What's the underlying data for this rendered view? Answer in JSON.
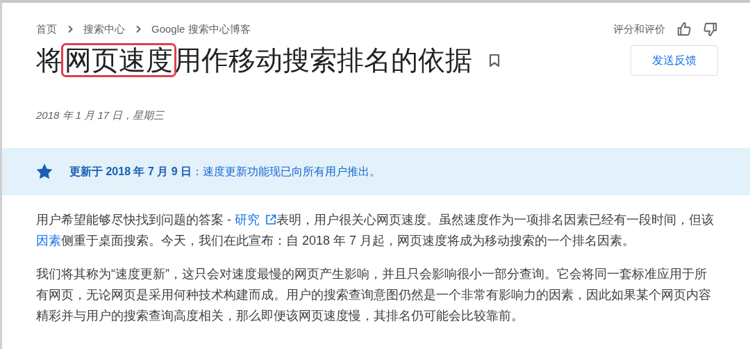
{
  "breadcrumbs": [
    "首页",
    "搜索中心",
    "Google 搜索中心博客"
  ],
  "rating": {
    "label": "评分和评价"
  },
  "title": [
    {
      "text": "将",
      "kind": "plain"
    },
    {
      "text": "网页速度",
      "kind": "highlight"
    },
    {
      "text": "用作移动搜索排名的依据",
      "kind": "plain"
    }
  ],
  "feedback_button": "发送反馈",
  "date": "2018 年 1 月 17 日，星期三",
  "notice": {
    "lead": "更新于 2018 年 7 月 9 日",
    "text": "：速度更新功能现已向所有用户推出。"
  },
  "paragraphs": [
    [
      {
        "text": "用户希望能够尽快找到问题的答案 - ",
        "kind": "text"
      },
      {
        "text": "研究",
        "kind": "external_link"
      },
      {
        "text": "表明，用户很关心网页速度。虽然速度作为一项排名因素已经有一段时间，但该",
        "kind": "text"
      },
      {
        "text": "因素",
        "kind": "link"
      },
      {
        "text": "侧重于桌面搜索。今天，我们在此宣布：自 2018 年 7 月起，网页速度将成为移动搜索的一个排名因素。",
        "kind": "text"
      }
    ],
    [
      {
        "text": "我们将其称为“速度更新”，这只会对速度最慢的网页产生影响，并且只会影响很小一部分查询。它会将同一套标准应用于所有网页，无论网页是采用何种技术构建而成。用户的搜索查询意图仍然是一个非常有影响力的因素，因此如果某个网页内容精彩并与用户的搜索查询高度相关，那么即便该网页速度慢，其排名仍可能会比较靠前。",
        "kind": "text"
      }
    ]
  ]
}
